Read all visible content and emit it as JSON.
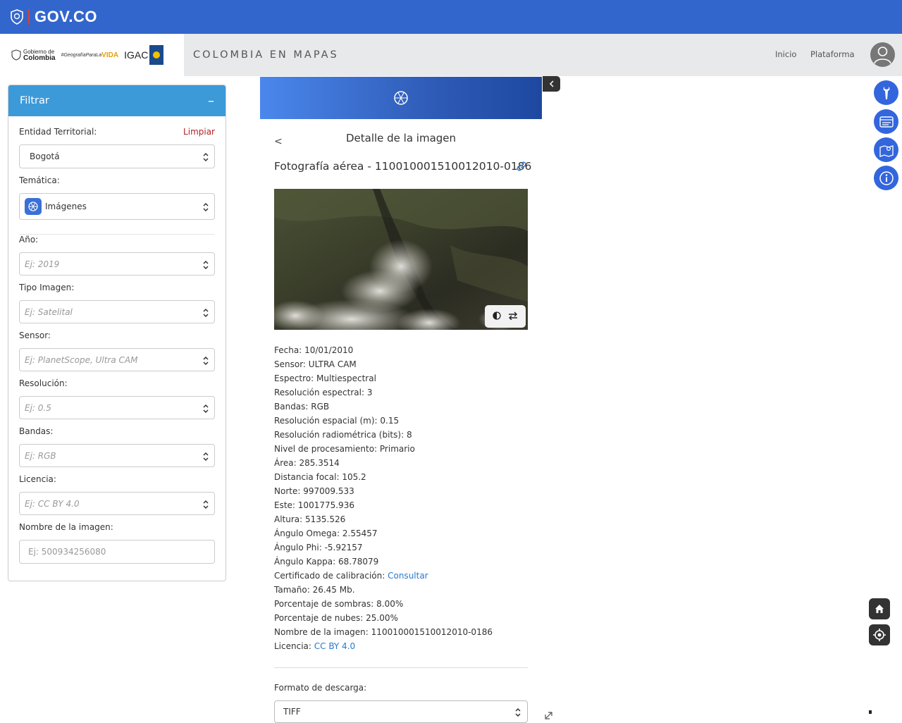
{
  "govbar": {
    "label": "GOV.CO"
  },
  "header": {
    "gov_logo_line1": "Gobierno de",
    "gov_logo_line2": "Colombia",
    "geo_logo_prefix": "#GeografíaParaLa",
    "geo_logo_vida": "VIDA",
    "igac_logo": "IGAC",
    "site_title": "COLOMBIA EN MAPAS",
    "nav": {
      "inicio": "Inicio",
      "plataforma": "Plataforma"
    }
  },
  "filter": {
    "title": "Filtrar",
    "collapse_symbol": "–",
    "clear_label": "Limpiar",
    "fields": {
      "entidad": {
        "label": "Entidad Territorial:",
        "value": "Bogotá"
      },
      "tematica": {
        "label": "Temática:",
        "value": "Imágenes"
      },
      "anio": {
        "label": "Año:",
        "placeholder": "Ej: 2019"
      },
      "tipo": {
        "label": "Tipo Imagen:",
        "placeholder": "Ej: Satelital"
      },
      "sensor": {
        "label": "Sensor:",
        "placeholder": "Ej: PlanetScope, Ultra CAM"
      },
      "resolucion": {
        "label": "Resolución:",
        "placeholder": "Ej: 0.5"
      },
      "bandas": {
        "label": "Bandas:",
        "placeholder": "Ej: RGB"
      },
      "licencia": {
        "label": "Licencia:",
        "placeholder": "Ej: CC BY 4.0"
      },
      "nombre": {
        "label": "Nombre de la imagen:",
        "placeholder": "Ej: 500934256080"
      }
    }
  },
  "detail": {
    "back_symbol": "<",
    "title": "Detalle de la imagen",
    "image_name": "Fotografía aérea - 110010001510012010-0186",
    "attributes": [
      {
        "label": "Fecha:",
        "value": "10/01/2010"
      },
      {
        "label": "Sensor:",
        "value": "ULTRA CAM"
      },
      {
        "label": "Espectro:",
        "value": "Multiespectral"
      },
      {
        "label": "Resolución espectral:",
        "value": "3"
      },
      {
        "label": "Bandas:",
        "value": "RGB"
      },
      {
        "label": "Resolución espacial (m):",
        "value": "0.15"
      },
      {
        "label": "Resolución radiométrica (bits):",
        "value": "8"
      },
      {
        "label": "Nivel de procesamiento:",
        "value": "Primario"
      },
      {
        "label": "Área:",
        "value": "285.3514"
      },
      {
        "label": "Distancia focal:",
        "value": "105.2"
      },
      {
        "label": "Norte:",
        "value": "997009.533"
      },
      {
        "label": "Este:",
        "value": "1001775.936"
      },
      {
        "label": "Altura:",
        "value": "5135.526"
      },
      {
        "label": "Ángulo Omega:",
        "value": "2.55457"
      },
      {
        "label": "Ángulo Phi:",
        "value": "-5.92157"
      },
      {
        "label": "Ángulo Kappa:",
        "value": "68.78079"
      },
      {
        "label": "Certificado de calibración:",
        "link": "Consultar"
      },
      {
        "label": "Tamaño:",
        "value": "26.45 Mb."
      },
      {
        "label": "Porcentaje de sombras:",
        "value": "8.00%"
      },
      {
        "label": "Porcentaje de nubes:",
        "value": "25.00%"
      },
      {
        "label": "Nombre de la imagen:",
        "value": "110010001510012010-0186"
      },
      {
        "label": "Licencia:",
        "link": "CC BY 4.0"
      }
    ],
    "download_format_label": "Formato de descarga:",
    "download_format_value": "TIFF"
  },
  "colors": {
    "gov_blue": "#3366cc",
    "accent_blue": "#3366dd",
    "filter_header": "#3c9ad9",
    "clear_red": "#b02020",
    "link": "#2a7ac8"
  },
  "icons": [
    "shield-icon",
    "aperture-icon",
    "link-icon",
    "contrast-icon",
    "swap-icon",
    "wrench-icon",
    "layers-icon",
    "map-icon",
    "info-icon",
    "home-icon",
    "locate-icon",
    "chevron-left-icon",
    "user-icon",
    "expand-icon"
  ]
}
